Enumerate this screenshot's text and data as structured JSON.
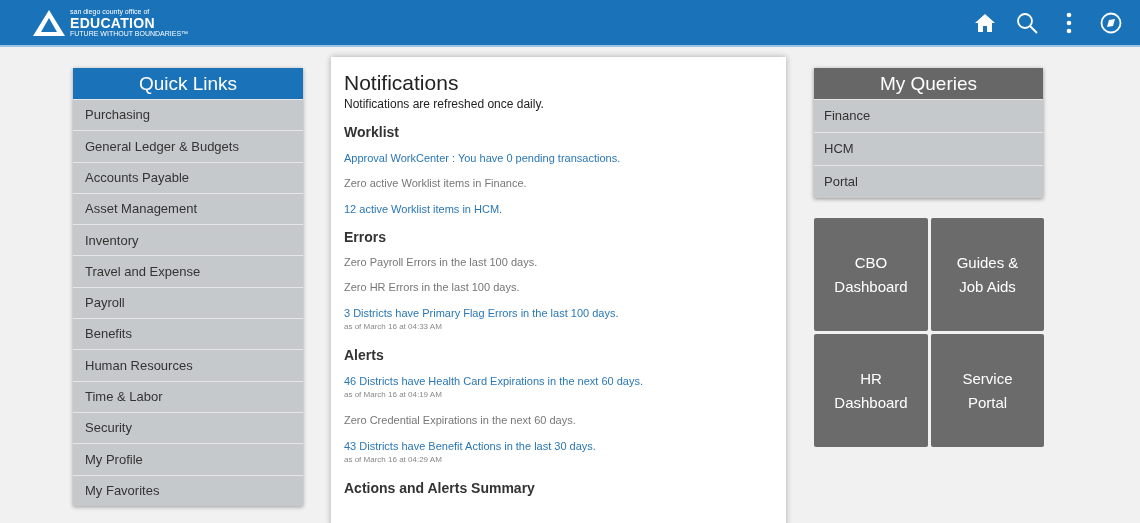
{
  "header": {
    "logo": {
      "tagline_top": "san diego county office of",
      "name": "EDUCATION",
      "tagline_bottom": "FUTURE WITHOUT BOUNDARIES™"
    }
  },
  "quick_links": {
    "title": "Quick Links",
    "items": [
      "Purchasing",
      "General Ledger & Budgets",
      "Accounts Payable",
      "Asset Management",
      "Inventory",
      "Travel and Expense",
      "Payroll",
      "Benefits",
      "Human Resources",
      "Time & Labor",
      "Security",
      "My Profile",
      "My Favorites"
    ]
  },
  "notifications": {
    "title": "Notifications",
    "subtitle": "Notifications are refreshed once daily.",
    "sections": [
      {
        "heading": "Worklist",
        "items": [
          {
            "kind": "link",
            "text": "Approval WorkCenter : You have 0 pending transactions."
          },
          {
            "kind": "plain",
            "text": "Zero active Worklist items in Finance."
          },
          {
            "kind": "link",
            "text": "12 active Worklist items in HCM."
          }
        ]
      },
      {
        "heading": "Errors",
        "items": [
          {
            "kind": "plain",
            "text": "Zero Payroll Errors in the last 100 days."
          },
          {
            "kind": "plain",
            "text": "Zero HR Errors in the last 100 days."
          },
          {
            "kind": "link",
            "text": "3 Districts have Primary Flag Errors in the last 100 days.",
            "timestamp": "as of March 16 at 04:33 AM"
          }
        ]
      },
      {
        "heading": "Alerts",
        "items": [
          {
            "kind": "link",
            "text": "46 Districts have Health Card Expirations in the next 60 days.",
            "timestamp": "as of March 16 at 04:19 AM"
          },
          {
            "kind": "plain",
            "text": "Zero Credential Expirations in the next 60 days."
          },
          {
            "kind": "link",
            "text": "43 Districts have Benefit Actions in the last 30 days.",
            "timestamp": "as of March 16 at 04:29 AM"
          }
        ]
      },
      {
        "heading": "Actions and Alerts Summary"
      }
    ]
  },
  "my_queries": {
    "title": "My Queries",
    "items": [
      "Finance",
      "HCM",
      "Portal"
    ]
  },
  "tiles": [
    "CBO Dashboard",
    "Guides & Job Aids",
    "HR Dashboard",
    "Service Portal"
  ]
}
